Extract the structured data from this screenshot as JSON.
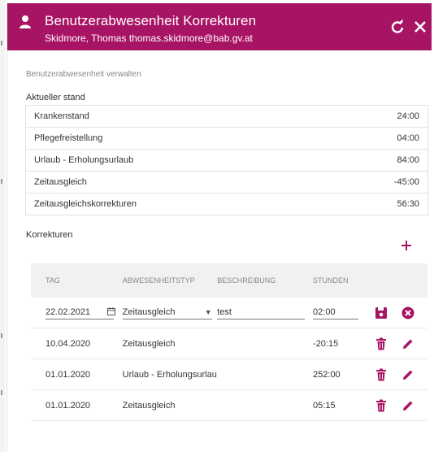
{
  "header": {
    "title": "Benutzerabwesenheit Korrekturen",
    "subtitle": "Skidmore, Thomas thomas.skidmore@bab.gv.at",
    "refresh_icon": "refresh-icon",
    "close_icon": "close-icon"
  },
  "section_caption": "Benutzerabwesenheit verwalten",
  "current_status": {
    "caption": "Aktueller stand",
    "rows": [
      {
        "label": "Krankenstand",
        "value": "24:00"
      },
      {
        "label": "Pflegefreistellung",
        "value": "04:00"
      },
      {
        "label": "Urlaub - Erholungsurlaub",
        "value": "84:00"
      },
      {
        "label": "Zeitausgleich",
        "value": "-45:00"
      },
      {
        "label": "Zeitausgleichskorrekturen",
        "value": "56:30"
      }
    ]
  },
  "corrections": {
    "caption": "Korrekturen",
    "headers": {
      "tag": "TAG",
      "typ": "ABWESENHEITSTYP",
      "beschreibung": "BESCHREIBUNG",
      "stunden": "STUNDEN"
    },
    "edit_row": {
      "tag": "22.02.2021",
      "typ": "Zeitausgleich",
      "beschreibung": "test",
      "stunden": "02:00"
    },
    "rows": [
      {
        "tag": "10.04.2020",
        "typ": "Zeitausgleich",
        "beschreibung": "",
        "stunden": "-20:15"
      },
      {
        "tag": "01.01.2020",
        "typ": "Urlaub - Erholungsurlau",
        "beschreibung": "",
        "stunden": "252:00"
      },
      {
        "tag": "01.01.2020",
        "typ": "Zeitausgleich",
        "beschreibung": "",
        "stunden": "05:15"
      }
    ]
  },
  "colors": {
    "brand": "#a81464",
    "delete": "#a81464",
    "cancel": "#a81464"
  }
}
